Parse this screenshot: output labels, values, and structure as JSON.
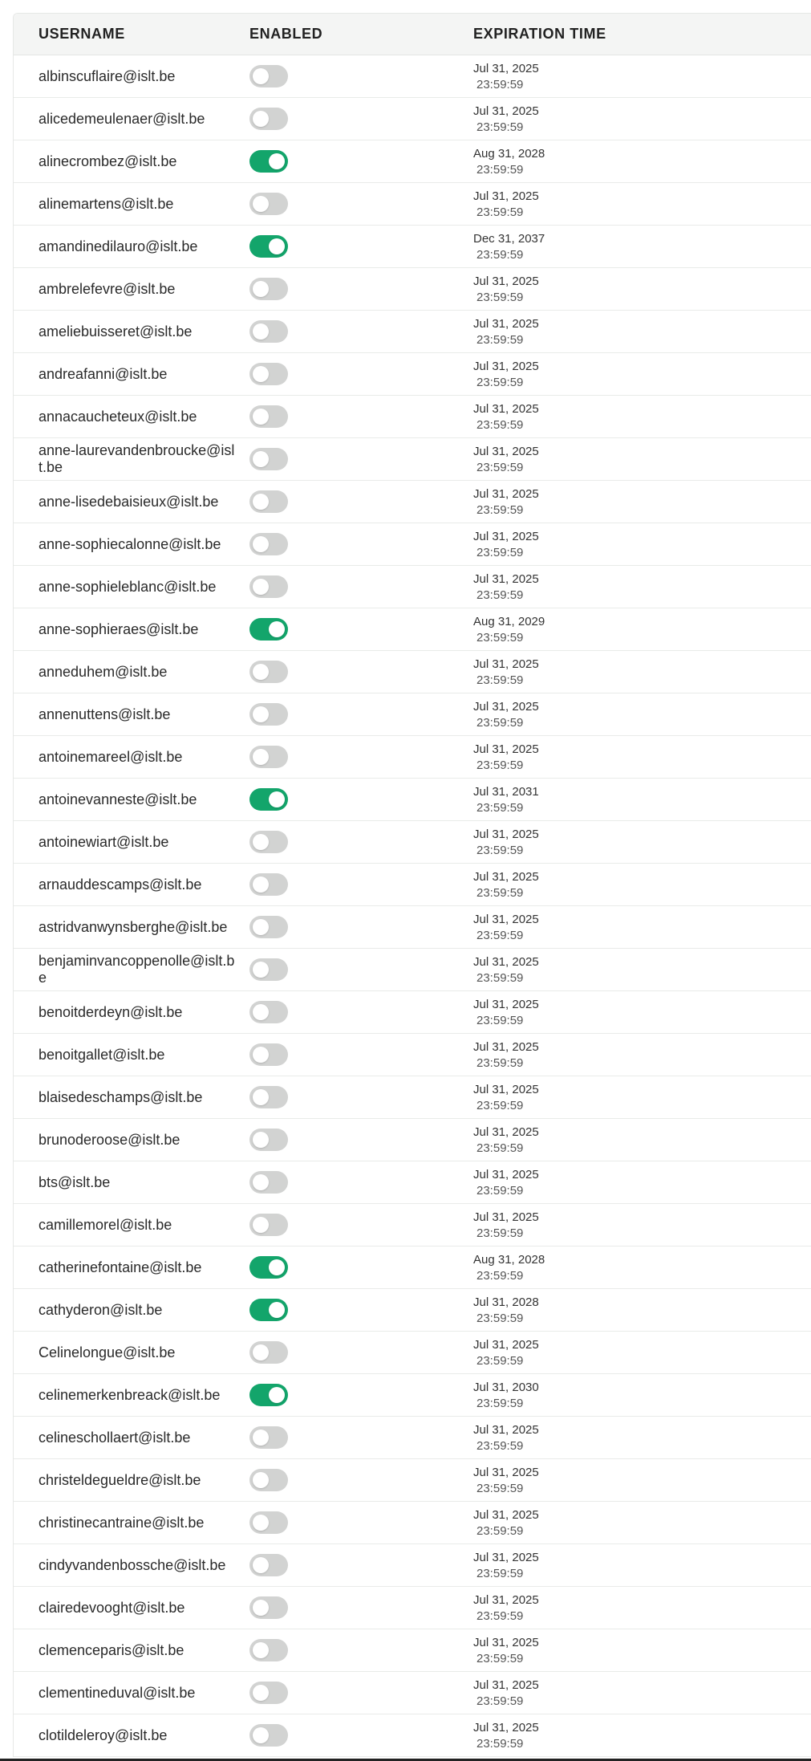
{
  "header": {
    "username": "USERNAME",
    "enabled": "ENABLED",
    "expiration": "EXPIRATION TIME"
  },
  "colors": {
    "toggle_on": "#13a56b",
    "toggle_off": "#d2d3d2"
  },
  "rows": [
    {
      "username": "albinscuflaire@islt.be",
      "enabled": false,
      "date": "Jul 31, 2025",
      "time": "23:59:59"
    },
    {
      "username": "alicedemeulenaer@islt.be",
      "enabled": false,
      "date": "Jul 31, 2025",
      "time": "23:59:59"
    },
    {
      "username": "alinecrombez@islt.be",
      "enabled": true,
      "date": "Aug 31, 2028",
      "time": "23:59:59"
    },
    {
      "username": "alinemartens@islt.be",
      "enabled": false,
      "date": "Jul 31, 2025",
      "time": "23:59:59"
    },
    {
      "username": "amandinedilauro@islt.be",
      "enabled": true,
      "date": "Dec 31, 2037",
      "time": "23:59:59"
    },
    {
      "username": "ambrelefevre@islt.be",
      "enabled": false,
      "date": "Jul 31, 2025",
      "time": "23:59:59"
    },
    {
      "username": "ameliebuisseret@islt.be",
      "enabled": false,
      "date": "Jul 31, 2025",
      "time": "23:59:59"
    },
    {
      "username": "andreafanni@islt.be",
      "enabled": false,
      "date": "Jul 31, 2025",
      "time": "23:59:59"
    },
    {
      "username": "annacaucheteux@islt.be",
      "enabled": false,
      "date": "Jul 31, 2025",
      "time": "23:59:59"
    },
    {
      "username": "anne-laurevandenbroucke@islt.be",
      "enabled": false,
      "date": "Jul 31, 2025",
      "time": "23:59:59"
    },
    {
      "username": "anne-lisedebaisieux@islt.be",
      "enabled": false,
      "date": "Jul 31, 2025",
      "time": "23:59:59"
    },
    {
      "username": "anne-sophiecalonne@islt.be",
      "enabled": false,
      "date": "Jul 31, 2025",
      "time": "23:59:59"
    },
    {
      "username": "anne-sophieleblanc@islt.be",
      "enabled": false,
      "date": "Jul 31, 2025",
      "time": "23:59:59"
    },
    {
      "username": "anne-sophieraes@islt.be",
      "enabled": true,
      "date": "Aug 31, 2029",
      "time": "23:59:59"
    },
    {
      "username": "anneduhem@islt.be",
      "enabled": false,
      "date": "Jul 31, 2025",
      "time": "23:59:59"
    },
    {
      "username": "annenuttens@islt.be",
      "enabled": false,
      "date": "Jul 31, 2025",
      "time": "23:59:59"
    },
    {
      "username": "antoinemareel@islt.be",
      "enabled": false,
      "date": "Jul 31, 2025",
      "time": "23:59:59"
    },
    {
      "username": "antoinevanneste@islt.be",
      "enabled": true,
      "date": "Jul 31, 2031",
      "time": "23:59:59"
    },
    {
      "username": "antoinewiart@islt.be",
      "enabled": false,
      "date": "Jul 31, 2025",
      "time": "23:59:59"
    },
    {
      "username": "arnauddescamps@islt.be",
      "enabled": false,
      "date": "Jul 31, 2025",
      "time": "23:59:59"
    },
    {
      "username": "astridvanwynsberghe@islt.be",
      "enabled": false,
      "date": "Jul 31, 2025",
      "time": "23:59:59"
    },
    {
      "username": "benjaminvancoppenolle@islt.be",
      "enabled": false,
      "date": "Jul 31, 2025",
      "time": "23:59:59"
    },
    {
      "username": "benoitderdeyn@islt.be",
      "enabled": false,
      "date": "Jul 31, 2025",
      "time": "23:59:59"
    },
    {
      "username": "benoitgallet@islt.be",
      "enabled": false,
      "date": "Jul 31, 2025",
      "time": "23:59:59"
    },
    {
      "username": "blaisedeschamps@islt.be",
      "enabled": false,
      "date": "Jul 31, 2025",
      "time": "23:59:59"
    },
    {
      "username": "brunoderoose@islt.be",
      "enabled": false,
      "date": "Jul 31, 2025",
      "time": "23:59:59"
    },
    {
      "username": "bts@islt.be",
      "enabled": false,
      "date": "Jul 31, 2025",
      "time": "23:59:59"
    },
    {
      "username": "camillemorel@islt.be",
      "enabled": false,
      "date": "Jul 31, 2025",
      "time": "23:59:59"
    },
    {
      "username": "catherinefontaine@islt.be",
      "enabled": true,
      "date": "Aug 31, 2028",
      "time": "23:59:59"
    },
    {
      "username": "cathyderon@islt.be",
      "enabled": true,
      "date": "Jul 31, 2028",
      "time": "23:59:59"
    },
    {
      "username": "Celinelongue@islt.be",
      "enabled": false,
      "date": "Jul 31, 2025",
      "time": "23:59:59"
    },
    {
      "username": "celinemerkenbreack@islt.be",
      "enabled": true,
      "date": "Jul 31, 2030",
      "time": "23:59:59"
    },
    {
      "username": "celineschollaert@islt.be",
      "enabled": false,
      "date": "Jul 31, 2025",
      "time": "23:59:59"
    },
    {
      "username": "christeldegueldre@islt.be",
      "enabled": false,
      "date": "Jul 31, 2025",
      "time": "23:59:59"
    },
    {
      "username": "christinecantraine@islt.be",
      "enabled": false,
      "date": "Jul 31, 2025",
      "time": "23:59:59"
    },
    {
      "username": "cindyvandenbossche@islt.be",
      "enabled": false,
      "date": "Jul 31, 2025",
      "time": "23:59:59"
    },
    {
      "username": "clairedevooght@islt.be",
      "enabled": false,
      "date": "Jul 31, 2025",
      "time": "23:59:59"
    },
    {
      "username": "clemenceparis@islt.be",
      "enabled": false,
      "date": "Jul 31, 2025",
      "time": "23:59:59"
    },
    {
      "username": "clementineduval@islt.be",
      "enabled": false,
      "date": "Jul 31, 2025",
      "time": "23:59:59"
    },
    {
      "username": "clotildeleroy@islt.be",
      "enabled": false,
      "date": "Jul 31, 2025",
      "time": "23:59:59"
    }
  ]
}
